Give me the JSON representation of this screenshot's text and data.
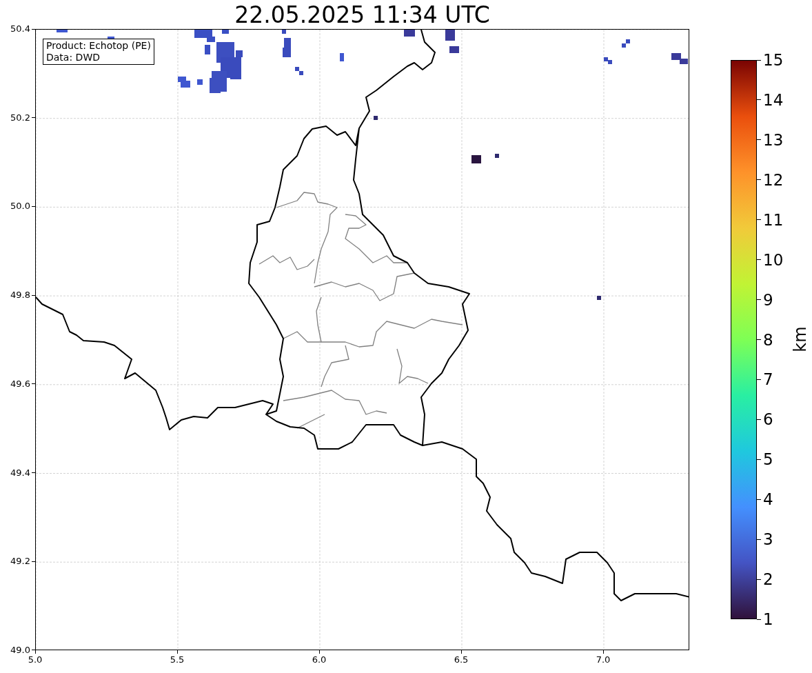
{
  "title": "22.05.2025 11:34 UTC",
  "map": {
    "info_lines": [
      "Product: Echotop (PE)",
      "Data: DWD"
    ],
    "xticks": [
      "5.0",
      "5.5",
      "6.0",
      "6.5",
      "7.0"
    ],
    "yticks": [
      "50.4",
      "50.2",
      "50.0",
      "49.8",
      "49.6",
      "49.4",
      "49.2",
      "49.0"
    ]
  },
  "colorbar": {
    "label": "km",
    "ticks": [
      "15",
      "14",
      "13",
      "12",
      "11",
      "10",
      "9",
      "8",
      "7",
      "6",
      "5",
      "4",
      "3",
      "2",
      "1"
    ]
  }
}
